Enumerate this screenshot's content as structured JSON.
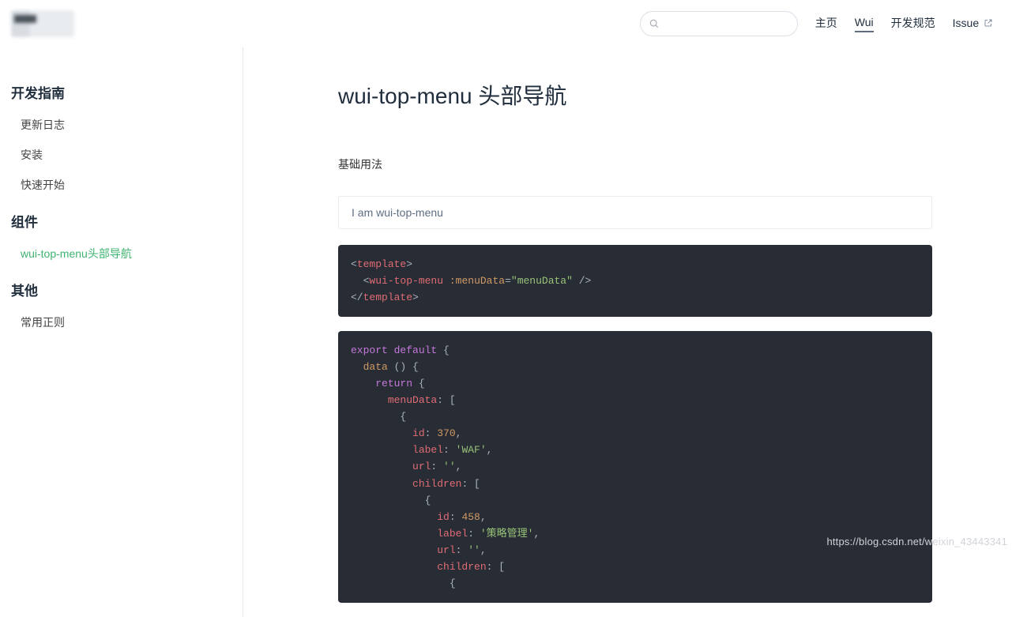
{
  "header": {
    "nav": [
      {
        "label": "主页",
        "active": false
      },
      {
        "label": "Wui",
        "active": true
      },
      {
        "label": "开发规范",
        "active": false
      },
      {
        "label": "Issue",
        "active": false,
        "external": true
      }
    ]
  },
  "sidebar": {
    "groups": [
      {
        "title": "开发指南",
        "items": [
          {
            "label": "更新日志",
            "active": false
          },
          {
            "label": "安装",
            "active": false
          },
          {
            "label": "快速开始",
            "active": false
          }
        ]
      },
      {
        "title": "组件",
        "items": [
          {
            "label": "wui-top-menu头部导航",
            "active": true
          }
        ]
      },
      {
        "title": "其他",
        "items": [
          {
            "label": "常用正则",
            "active": false
          }
        ]
      }
    ]
  },
  "page": {
    "title": "wui-top-menu 头部导航",
    "section_label": "基础用法",
    "demo_text": "I am wui-top-menu",
    "code_template": "<template>\n  <wui-top-menu :menuData=\"menuData\" />\n</template>",
    "code_script": "export default {\n  data () {\n    return {\n      menuData: [\n        {\n          id: 370,\n          label: 'WAF',\n          url: '',\n          children: [\n            {\n              id: 458,\n              label: '策略管理',\n              url: '',\n              children: [\n                {"
  },
  "watermark": "https://blog.csdn.net/weixin_43443341"
}
